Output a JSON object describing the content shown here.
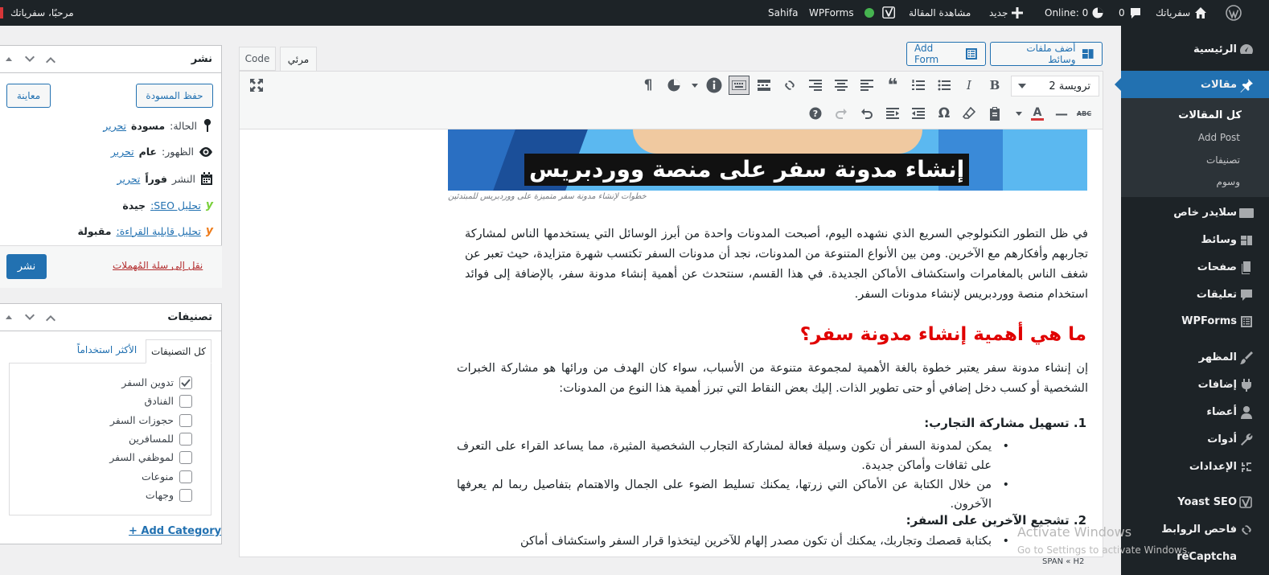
{
  "admin_bar": {
    "greeting": "مرحبًا، سفرياتك",
    "sahifa": "Sahifa",
    "wpforms": "WPForms",
    "view_post": "مشاهدة المقالة",
    "new": "جديد",
    "online": "Online: 0",
    "comments": "0",
    "site_name": "سفرياتك"
  },
  "sidebar": {
    "items": [
      {
        "label": "الرئيسية",
        "icon": "dashboard-icon"
      },
      {
        "label": "مقالات",
        "icon": "pin-icon",
        "current": true
      },
      {
        "label": "سلايدر خاص",
        "icon": "slider-icon"
      },
      {
        "label": "وسائط",
        "icon": "media-icon"
      },
      {
        "label": "صفحات",
        "icon": "pages-icon"
      },
      {
        "label": "تعليقات",
        "icon": "comments-icon"
      },
      {
        "label": "WPForms",
        "icon": "forms-icon"
      },
      {
        "label": "المظهر",
        "icon": "appearance-icon"
      },
      {
        "label": "إضافات",
        "icon": "plugins-icon"
      },
      {
        "label": "أعضاء",
        "icon": "users-icon"
      },
      {
        "label": "أدوات",
        "icon": "tools-icon"
      },
      {
        "label": "الإعدادات",
        "icon": "settings-icon"
      },
      {
        "label": "Yoast SEO",
        "icon": "yoast-icon"
      },
      {
        "label": "فاحص الروابط",
        "icon": "link-checker-icon"
      },
      {
        "label": "reCaptcha",
        "icon": "recaptcha-icon"
      }
    ],
    "submenu": [
      "كل المقالات",
      "Add Post",
      "تصنيفات",
      "وسوم"
    ]
  },
  "editor": {
    "add_media": "أضف ملفات وسائط",
    "add_form": "Add Form",
    "tab_visual": "مرئي",
    "tab_code": "Code",
    "format_select": "ترويسة 2",
    "image_title": "إنشاء مدونة سفر على منصة ووردبريس",
    "image_caption": "خطوات لإنشاء مدونة سفر متميزة على ووردبريس للمبتدئين",
    "intro": "في ظل التطور التكنولوجي السريع الذي نشهده اليوم، أصبحت المدونات واحدة من أبرز الوسائل التي يستخدمها الناس لمشاركة تجاربهم وأفكارهم مع الآخرين. ومن بين الأنواع المتنوعة من المدونات، نجد أن مدونات السفر تكتسب شهرة متزايدة، حيث تعبر عن شغف الناس بالمغامرات واستكشاف الأماكن الجديدة. في هذا القسم، سنتحدث عن أهمية إنشاء مدونة سفر، بالإضافة إلى فوائد استخدام منصة ووردبريس لإنشاء مدونات السفر.",
    "heading": "ما هي أهمية إنشاء مدونة سفر؟",
    "para2": "إن إنشاء مدونة سفر يعتبر خطوة بالغة الأهمية لمجموعة متنوعة من الأسباب، سواء كان الهدف من ورائها هو مشاركة الخبرات الشخصية أو كسب دخل إضافي أو حتى تطوير الذات. إليك بعض النقاط التي تبرز أهمية هذا النوع من المدونات:",
    "list1_title": "1. تسهيل مشاركة التجارب:",
    "bullet1": "يمكن لمدونة السفر أن تكون وسيلة فعالة لمشاركة التجارب الشخصية المثيرة، مما يساعد القراء على التعرف على ثقافات وأماكن جديدة.",
    "bullet2": "من خلال الكتابة عن الأماكن التي زرتها، يمكنك تسليط الضوء على الجمال والاهتمام بتفاصيل ربما لم يعرفها الآخرون.",
    "list2_title": "2. تشجيع الآخرين على السفر:",
    "bullet3": "بكتابة قصصك وتجاربك، يمكنك أن تكون مصدر إلهام للآخرين ليتخذوا قرار السفر واستكشاف أماكن",
    "path": "SPAN « H2"
  },
  "publish": {
    "title": "نشر",
    "save_draft": "حفظ المسودة",
    "preview": "معاينة",
    "status_label": "الحالة:",
    "status_value": "مسودة",
    "visibility_label": "الظهور:",
    "visibility_value": "عام",
    "publish_label": "النشر",
    "publish_value": "فوراً",
    "edit": "تحرير",
    "seo_label": "تحليل SEO:",
    "seo_value": "جيدة",
    "read_label": "تحليل قابلية القراءة:",
    "read_value": "مقبولة",
    "trash": "نقل إلى سلة المُهملات",
    "publish_button": "نشر"
  },
  "categories": {
    "title": "تصنيفات",
    "tab_all": "كل التصنيفات",
    "tab_most": "الأكثر استخداماً",
    "items": [
      {
        "label": "تدوين السفر",
        "checked": true
      },
      {
        "label": "الفنادق",
        "checked": false
      },
      {
        "label": "حجوزات السفر",
        "checked": false
      },
      {
        "label": "للمسافرين",
        "checked": false
      },
      {
        "label": "لموظفي السفر",
        "checked": false
      },
      {
        "label": "منوعات",
        "checked": false
      },
      {
        "label": "وجهات",
        "checked": false
      }
    ],
    "add": "+ Add Category"
  },
  "watermark": {
    "line1": "Activate Windows",
    "line2": "Go to Settings to activate Windows."
  },
  "colors": {
    "accent": "#2271b1",
    "heading_red": "#e00000",
    "admin_dark": "#1d2327"
  }
}
